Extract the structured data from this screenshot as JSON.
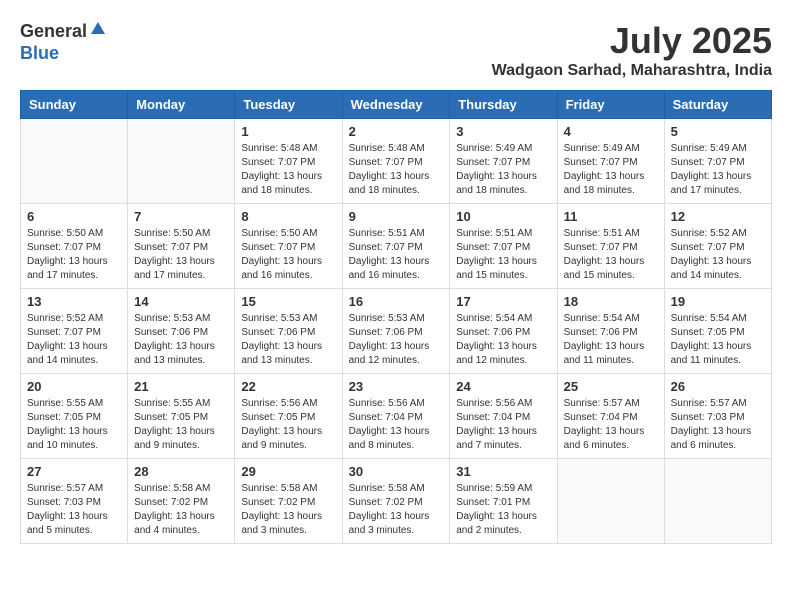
{
  "logo": {
    "general": "General",
    "blue": "Blue"
  },
  "title": {
    "month_year": "July 2025",
    "location": "Wadgaon Sarhad, Maharashtra, India"
  },
  "days_of_week": [
    "Sunday",
    "Monday",
    "Tuesday",
    "Wednesday",
    "Thursday",
    "Friday",
    "Saturday"
  ],
  "weeks": [
    [
      {
        "day": "",
        "info": ""
      },
      {
        "day": "",
        "info": ""
      },
      {
        "day": "1",
        "info": "Sunrise: 5:48 AM\nSunset: 7:07 PM\nDaylight: 13 hours and 18 minutes."
      },
      {
        "day": "2",
        "info": "Sunrise: 5:48 AM\nSunset: 7:07 PM\nDaylight: 13 hours and 18 minutes."
      },
      {
        "day": "3",
        "info": "Sunrise: 5:49 AM\nSunset: 7:07 PM\nDaylight: 13 hours and 18 minutes."
      },
      {
        "day": "4",
        "info": "Sunrise: 5:49 AM\nSunset: 7:07 PM\nDaylight: 13 hours and 18 minutes."
      },
      {
        "day": "5",
        "info": "Sunrise: 5:49 AM\nSunset: 7:07 PM\nDaylight: 13 hours and 17 minutes."
      }
    ],
    [
      {
        "day": "6",
        "info": "Sunrise: 5:50 AM\nSunset: 7:07 PM\nDaylight: 13 hours and 17 minutes."
      },
      {
        "day": "7",
        "info": "Sunrise: 5:50 AM\nSunset: 7:07 PM\nDaylight: 13 hours and 17 minutes."
      },
      {
        "day": "8",
        "info": "Sunrise: 5:50 AM\nSunset: 7:07 PM\nDaylight: 13 hours and 16 minutes."
      },
      {
        "day": "9",
        "info": "Sunrise: 5:51 AM\nSunset: 7:07 PM\nDaylight: 13 hours and 16 minutes."
      },
      {
        "day": "10",
        "info": "Sunrise: 5:51 AM\nSunset: 7:07 PM\nDaylight: 13 hours and 15 minutes."
      },
      {
        "day": "11",
        "info": "Sunrise: 5:51 AM\nSunset: 7:07 PM\nDaylight: 13 hours and 15 minutes."
      },
      {
        "day": "12",
        "info": "Sunrise: 5:52 AM\nSunset: 7:07 PM\nDaylight: 13 hours and 14 minutes."
      }
    ],
    [
      {
        "day": "13",
        "info": "Sunrise: 5:52 AM\nSunset: 7:07 PM\nDaylight: 13 hours and 14 minutes."
      },
      {
        "day": "14",
        "info": "Sunrise: 5:53 AM\nSunset: 7:06 PM\nDaylight: 13 hours and 13 minutes."
      },
      {
        "day": "15",
        "info": "Sunrise: 5:53 AM\nSunset: 7:06 PM\nDaylight: 13 hours and 13 minutes."
      },
      {
        "day": "16",
        "info": "Sunrise: 5:53 AM\nSunset: 7:06 PM\nDaylight: 13 hours and 12 minutes."
      },
      {
        "day": "17",
        "info": "Sunrise: 5:54 AM\nSunset: 7:06 PM\nDaylight: 13 hours and 12 minutes."
      },
      {
        "day": "18",
        "info": "Sunrise: 5:54 AM\nSunset: 7:06 PM\nDaylight: 13 hours and 11 minutes."
      },
      {
        "day": "19",
        "info": "Sunrise: 5:54 AM\nSunset: 7:05 PM\nDaylight: 13 hours and 11 minutes."
      }
    ],
    [
      {
        "day": "20",
        "info": "Sunrise: 5:55 AM\nSunset: 7:05 PM\nDaylight: 13 hours and 10 minutes."
      },
      {
        "day": "21",
        "info": "Sunrise: 5:55 AM\nSunset: 7:05 PM\nDaylight: 13 hours and 9 minutes."
      },
      {
        "day": "22",
        "info": "Sunrise: 5:56 AM\nSunset: 7:05 PM\nDaylight: 13 hours and 9 minutes."
      },
      {
        "day": "23",
        "info": "Sunrise: 5:56 AM\nSunset: 7:04 PM\nDaylight: 13 hours and 8 minutes."
      },
      {
        "day": "24",
        "info": "Sunrise: 5:56 AM\nSunset: 7:04 PM\nDaylight: 13 hours and 7 minutes."
      },
      {
        "day": "25",
        "info": "Sunrise: 5:57 AM\nSunset: 7:04 PM\nDaylight: 13 hours and 6 minutes."
      },
      {
        "day": "26",
        "info": "Sunrise: 5:57 AM\nSunset: 7:03 PM\nDaylight: 13 hours and 6 minutes."
      }
    ],
    [
      {
        "day": "27",
        "info": "Sunrise: 5:57 AM\nSunset: 7:03 PM\nDaylight: 13 hours and 5 minutes."
      },
      {
        "day": "28",
        "info": "Sunrise: 5:58 AM\nSunset: 7:02 PM\nDaylight: 13 hours and 4 minutes."
      },
      {
        "day": "29",
        "info": "Sunrise: 5:58 AM\nSunset: 7:02 PM\nDaylight: 13 hours and 3 minutes."
      },
      {
        "day": "30",
        "info": "Sunrise: 5:58 AM\nSunset: 7:02 PM\nDaylight: 13 hours and 3 minutes."
      },
      {
        "day": "31",
        "info": "Sunrise: 5:59 AM\nSunset: 7:01 PM\nDaylight: 13 hours and 2 minutes."
      },
      {
        "day": "",
        "info": ""
      },
      {
        "day": "",
        "info": ""
      }
    ]
  ]
}
